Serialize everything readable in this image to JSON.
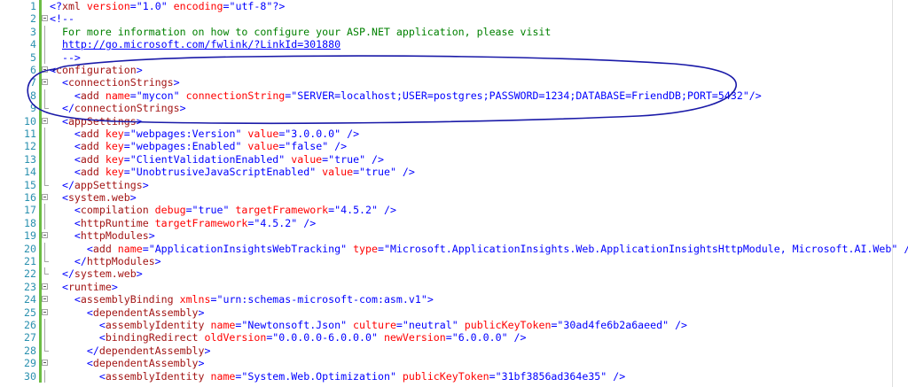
{
  "editor": {
    "lines": [
      {
        "n": "1",
        "segs": [
          [
            "dl",
            "<?"
          ],
          [
            "tg",
            "xml"
          ],
          [
            "at",
            " version"
          ],
          [
            "dl",
            "=\""
          ],
          [
            "vl",
            "1.0"
          ],
          [
            "dl",
            "\""
          ],
          [
            "at",
            " encoding"
          ],
          [
            "dl",
            "=\""
          ],
          [
            "vl",
            "utf-8"
          ],
          [
            "dl",
            "\"?>"
          ]
        ]
      },
      {
        "n": "2",
        "segs": [
          [
            "dl",
            "<!--"
          ]
        ]
      },
      {
        "n": "3",
        "segs": [
          [
            "cm",
            "  For more information on how to configure your ASP.NET application, please visit"
          ]
        ]
      },
      {
        "n": "4",
        "segs": [
          [
            "cm",
            "  "
          ],
          [
            "lk",
            "http://go.microsoft.com/fwlink/?LinkId=301880"
          ]
        ]
      },
      {
        "n": "5",
        "segs": [
          [
            "cm",
            "  "
          ],
          [
            "dl",
            "-->"
          ]
        ]
      },
      {
        "n": "6",
        "segs": [
          [
            "dl",
            "<"
          ],
          [
            "tg",
            "configuration"
          ],
          [
            "dl",
            ">"
          ]
        ]
      },
      {
        "n": "7",
        "segs": [
          [
            "dl",
            "  <"
          ],
          [
            "tg",
            "connectionStrings"
          ],
          [
            "dl",
            ">"
          ]
        ]
      },
      {
        "n": "8",
        "segs": [
          [
            "dl",
            "    <"
          ],
          [
            "tg",
            "add"
          ],
          [
            "at",
            " name"
          ],
          [
            "dl",
            "=\""
          ],
          [
            "vl",
            "mycon"
          ],
          [
            "dl",
            "\""
          ],
          [
            "at",
            " connectionString"
          ],
          [
            "dl",
            "=\""
          ],
          [
            "vl",
            "SERVER=localhost;USER=postgres;PASSWORD=1234;DATABASE=FriendDB;PORT=5432"
          ],
          [
            "dl",
            "\"/>"
          ]
        ]
      },
      {
        "n": "9",
        "segs": [
          [
            "dl",
            "  </"
          ],
          [
            "tg",
            "connectionStrings"
          ],
          [
            "dl",
            ">"
          ]
        ]
      },
      {
        "n": "10",
        "segs": [
          [
            "dl",
            "  <"
          ],
          [
            "tg",
            "appSettings"
          ],
          [
            "dl",
            ">"
          ]
        ]
      },
      {
        "n": "11",
        "segs": [
          [
            "dl",
            "    <"
          ],
          [
            "tg",
            "add"
          ],
          [
            "at",
            " key"
          ],
          [
            "dl",
            "=\""
          ],
          [
            "vl",
            "webpages:Version"
          ],
          [
            "dl",
            "\""
          ],
          [
            "at",
            " value"
          ],
          [
            "dl",
            "=\""
          ],
          [
            "vl",
            "3.0.0.0"
          ],
          [
            "dl",
            "\" />"
          ]
        ]
      },
      {
        "n": "12",
        "segs": [
          [
            "dl",
            "    <"
          ],
          [
            "tg",
            "add"
          ],
          [
            "at",
            " key"
          ],
          [
            "dl",
            "=\""
          ],
          [
            "vl",
            "webpages:Enabled"
          ],
          [
            "dl",
            "\""
          ],
          [
            "at",
            " value"
          ],
          [
            "dl",
            "=\""
          ],
          [
            "vl",
            "false"
          ],
          [
            "dl",
            "\" />"
          ]
        ]
      },
      {
        "n": "13",
        "segs": [
          [
            "dl",
            "    <"
          ],
          [
            "tg",
            "add"
          ],
          [
            "at",
            " key"
          ],
          [
            "dl",
            "=\""
          ],
          [
            "vl",
            "ClientValidationEnabled"
          ],
          [
            "dl",
            "\""
          ],
          [
            "at",
            " value"
          ],
          [
            "dl",
            "=\""
          ],
          [
            "vl",
            "true"
          ],
          [
            "dl",
            "\" />"
          ]
        ]
      },
      {
        "n": "14",
        "segs": [
          [
            "dl",
            "    <"
          ],
          [
            "tg",
            "add"
          ],
          [
            "at",
            " key"
          ],
          [
            "dl",
            "=\""
          ],
          [
            "vl",
            "UnobtrusiveJavaScriptEnabled"
          ],
          [
            "dl",
            "\""
          ],
          [
            "at",
            " value"
          ],
          [
            "dl",
            "=\""
          ],
          [
            "vl",
            "true"
          ],
          [
            "dl",
            "\" />"
          ]
        ]
      },
      {
        "n": "15",
        "segs": [
          [
            "dl",
            "  </"
          ],
          [
            "tg",
            "appSettings"
          ],
          [
            "dl",
            ">"
          ]
        ]
      },
      {
        "n": "16",
        "segs": [
          [
            "dl",
            "  <"
          ],
          [
            "tg",
            "system.web"
          ],
          [
            "dl",
            ">"
          ]
        ]
      },
      {
        "n": "17",
        "segs": [
          [
            "dl",
            "    <"
          ],
          [
            "tg",
            "compilation"
          ],
          [
            "at",
            " debug"
          ],
          [
            "dl",
            "=\""
          ],
          [
            "vl",
            "true"
          ],
          [
            "dl",
            "\""
          ],
          [
            "at",
            " targetFramework"
          ],
          [
            "dl",
            "=\""
          ],
          [
            "vl",
            "4.5.2"
          ],
          [
            "dl",
            "\" />"
          ]
        ]
      },
      {
        "n": "18",
        "segs": [
          [
            "dl",
            "    <"
          ],
          [
            "tg",
            "httpRuntime"
          ],
          [
            "at",
            " targetFramework"
          ],
          [
            "dl",
            "=\""
          ],
          [
            "vl",
            "4.5.2"
          ],
          [
            "dl",
            "\" />"
          ]
        ]
      },
      {
        "n": "19",
        "segs": [
          [
            "dl",
            "    <"
          ],
          [
            "tg",
            "httpModules"
          ],
          [
            "dl",
            ">"
          ]
        ]
      },
      {
        "n": "20",
        "segs": [
          [
            "dl",
            "      <"
          ],
          [
            "tg",
            "add"
          ],
          [
            "at",
            " name"
          ],
          [
            "dl",
            "=\""
          ],
          [
            "vl",
            "ApplicationInsightsWebTracking"
          ],
          [
            "dl",
            "\""
          ],
          [
            "at",
            " type"
          ],
          [
            "dl",
            "=\""
          ],
          [
            "vl",
            "Microsoft.ApplicationInsights.Web.ApplicationInsightsHttpModule, Microsoft.AI.Web"
          ],
          [
            "dl",
            "\" />"
          ]
        ]
      },
      {
        "n": "21",
        "segs": [
          [
            "dl",
            "    </"
          ],
          [
            "tg",
            "httpModules"
          ],
          [
            "dl",
            ">"
          ]
        ]
      },
      {
        "n": "22",
        "segs": [
          [
            "dl",
            "  </"
          ],
          [
            "tg",
            "system.web"
          ],
          [
            "dl",
            ">"
          ]
        ]
      },
      {
        "n": "23",
        "segs": [
          [
            "dl",
            "  <"
          ],
          [
            "tg",
            "runtime"
          ],
          [
            "dl",
            ">"
          ]
        ]
      },
      {
        "n": "24",
        "segs": [
          [
            "dl",
            "    <"
          ],
          [
            "tg",
            "assemblyBinding"
          ],
          [
            "at",
            " xmlns"
          ],
          [
            "dl",
            "=\""
          ],
          [
            "vl",
            "urn:schemas-microsoft-com:asm.v1"
          ],
          [
            "dl",
            "\">"
          ]
        ]
      },
      {
        "n": "25",
        "segs": [
          [
            "dl",
            "      <"
          ],
          [
            "tg",
            "dependentAssembly"
          ],
          [
            "dl",
            ">"
          ]
        ]
      },
      {
        "n": "26",
        "segs": [
          [
            "dl",
            "        <"
          ],
          [
            "tg",
            "assemblyIdentity"
          ],
          [
            "at",
            " name"
          ],
          [
            "dl",
            "=\""
          ],
          [
            "vl",
            "Newtonsoft.Json"
          ],
          [
            "dl",
            "\""
          ],
          [
            "at",
            " culture"
          ],
          [
            "dl",
            "=\""
          ],
          [
            "vl",
            "neutral"
          ],
          [
            "dl",
            "\""
          ],
          [
            "at",
            " publicKeyToken"
          ],
          [
            "dl",
            "=\""
          ],
          [
            "vl",
            "30ad4fe6b2a6aeed"
          ],
          [
            "dl",
            "\" />"
          ]
        ]
      },
      {
        "n": "27",
        "segs": [
          [
            "dl",
            "        <"
          ],
          [
            "tg",
            "bindingRedirect"
          ],
          [
            "at",
            " oldVersion"
          ],
          [
            "dl",
            "=\""
          ],
          [
            "vl",
            "0.0.0.0-6.0.0.0"
          ],
          [
            "dl",
            "\""
          ],
          [
            "at",
            " newVersion"
          ],
          [
            "dl",
            "=\""
          ],
          [
            "vl",
            "6.0.0.0"
          ],
          [
            "dl",
            "\" />"
          ]
        ]
      },
      {
        "n": "28",
        "segs": [
          [
            "dl",
            "      </"
          ],
          [
            "tg",
            "dependentAssembly"
          ],
          [
            "dl",
            ">"
          ]
        ]
      },
      {
        "n": "29",
        "segs": [
          [
            "dl",
            "      <"
          ],
          [
            "tg",
            "dependentAssembly"
          ],
          [
            "dl",
            ">"
          ]
        ]
      },
      {
        "n": "30",
        "segs": [
          [
            "dl",
            "        <"
          ],
          [
            "tg",
            "assemblyIdentity"
          ],
          [
            "at",
            " name"
          ],
          [
            "dl",
            "=\""
          ],
          [
            "vl",
            "System.Web.Optimization"
          ],
          [
            "dl",
            "\""
          ],
          [
            "at",
            " publicKeyToken"
          ],
          [
            "dl",
            "=\""
          ],
          [
            "vl",
            "31bf3856ad364e35"
          ],
          [
            "dl",
            "\" />"
          ]
        ]
      }
    ]
  },
  "colors": {
    "line_number": "#2b91af",
    "delimiter": "#0000ff",
    "tag": "#a31515",
    "attribute": "#ff0000",
    "value": "#0000ff",
    "comment": "#008000",
    "annotation_ink": "#1a1aa8"
  },
  "annotation": {
    "shape": "hand-drawn-ellipse",
    "encloses_lines": [
      "6",
      "7",
      "8",
      "9"
    ]
  }
}
